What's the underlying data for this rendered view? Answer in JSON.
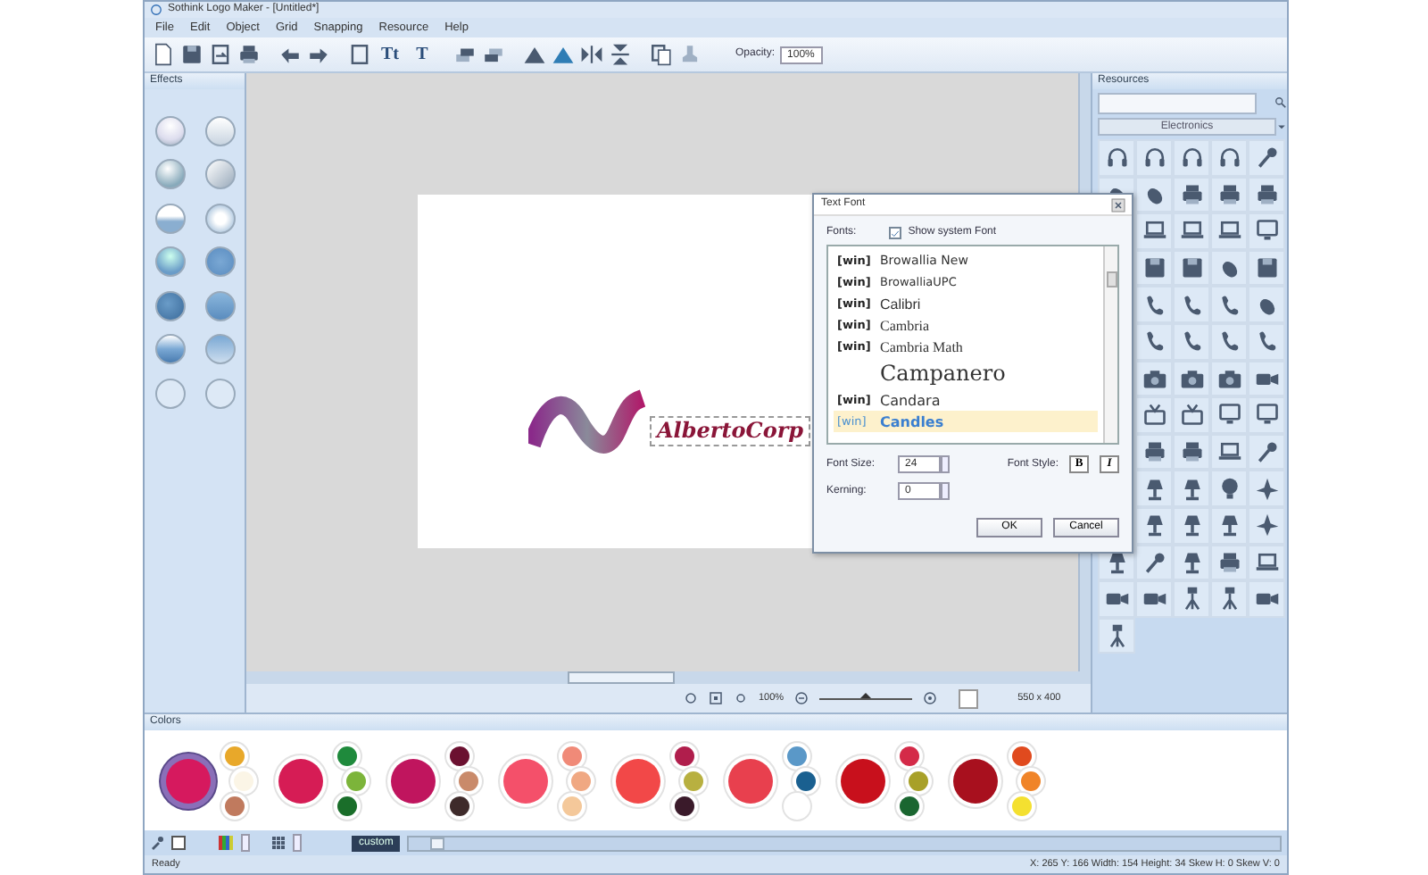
{
  "window": {
    "title": "Sothink Logo Maker - [Untitled*]"
  },
  "menu": [
    "File",
    "Edit",
    "Object",
    "Grid",
    "Snapping",
    "Resource",
    "Help"
  ],
  "toolbar": {
    "glyphs": [
      "Tt",
      "T"
    ],
    "opacity_label": "Opacity:",
    "opacity_value": "100%"
  },
  "effects_panel": {
    "title": "Effects"
  },
  "canvas": {
    "logo_text": "AlbertoCorp"
  },
  "zoom_bar": {
    "zoom": "100%",
    "level": 0.5,
    "size": "550 x 400"
  },
  "text_font_dialog": {
    "title": "Text Font",
    "fonts_label": "Fonts:",
    "show_system_font": {
      "label": "Show system Font",
      "checked": true
    },
    "fonts": [
      {
        "tag": "[win]",
        "name": "Browallia New",
        "selected": false
      },
      {
        "tag": "[win]",
        "name": "BrowalliaUPC",
        "selected": false
      },
      {
        "tag": "[win]",
        "name": "Calibri",
        "selected": false
      },
      {
        "tag": "[win]",
        "name": "Cambria",
        "selected": false
      },
      {
        "tag": "[win]",
        "name": "Cambria Math",
        "selected": false
      },
      {
        "name": "Campanero",
        "selected": false
      },
      {
        "tag": "[win]",
        "name": "Candara",
        "selected": false
      },
      {
        "tag": "[win]",
        "name": "Candles",
        "selected": true
      }
    ],
    "font_size_label": "Font Size:",
    "font_size": "24",
    "kerning_label": "Kerning:",
    "kerning": "0",
    "font_style_label": "Font Style:",
    "style_buttons": [
      "B",
      "I"
    ],
    "buttons": [
      "OK",
      "Cancel"
    ]
  },
  "resources_panel": {
    "title": "Resources",
    "category": "Electronics"
  },
  "colors_panel": {
    "title": "Colors",
    "palettes": [
      {
        "swatches": [
          {
            "color": "#d6195e"
          },
          {
            "color": "#e8a82a"
          },
          {
            "color": "#fbf5e6"
          },
          {
            "color": "#c07a5e"
          }
        ],
        "selected": true
      },
      {
        "swatches": [
          {
            "color": "#d61c55"
          },
          {
            "color": "#1f8a3c"
          },
          {
            "color": "#7cb43a"
          },
          {
            "color": "#1a6e2a"
          }
        ],
        "selected": false
      },
      {
        "swatches": [
          {
            "color": "#c0155e"
          },
          {
            "color": "#6b1030"
          },
          {
            "color": "#c98a6a"
          },
          {
            "color": "#3e2a2a"
          }
        ],
        "selected": false
      },
      {
        "swatches": [
          {
            "color": "#f4506a"
          },
          {
            "color": "#f08a78"
          },
          {
            "color": "#f0a882"
          },
          {
            "color": "#f4c89a"
          }
        ],
        "selected": false
      },
      {
        "swatches": [
          {
            "color": "#f24848"
          },
          {
            "color": "#b01e4c"
          },
          {
            "color": "#b8b040"
          },
          {
            "color": "#3a1a2a"
          }
        ],
        "selected": false
      },
      {
        "swatches": [
          {
            "color": "#e8404e"
          },
          {
            "color": "#5a98c8"
          },
          {
            "color": "#1a6090"
          },
          {
            "color": "#ffffff"
          }
        ],
        "selected": false
      },
      {
        "swatches": [
          {
            "color": "#c8101c"
          },
          {
            "color": "#d42a48"
          },
          {
            "color": "#a8a028"
          },
          {
            "color": "#1a6630"
          }
        ],
        "selected": false
      },
      {
        "swatches": [
          {
            "color": "#a8101e"
          },
          {
            "color": "#e04a1e"
          },
          {
            "color": "#f08428"
          },
          {
            "color": "#f4e030"
          }
        ],
        "selected": false
      }
    ],
    "custom_label": "custom"
  },
  "status_bar": {
    "left": "Ready",
    "right": "X: 265  Y: 166  Width: 154  Height: 34  Skew H: 0  Skew V: 0"
  }
}
